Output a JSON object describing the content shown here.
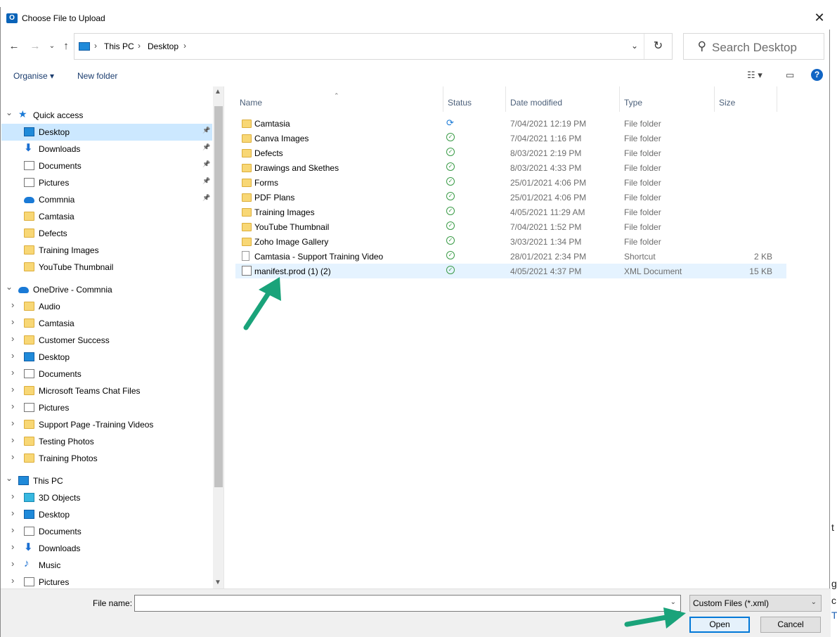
{
  "window": {
    "title": "Choose File to Upload",
    "app_icon": "O",
    "close": "✕"
  },
  "address": {
    "crumbs": [
      "This PC",
      "Desktop"
    ],
    "separator": "›",
    "dropdown": "⌄",
    "refresh": "↻"
  },
  "search": {
    "placeholder": "Search Desktop"
  },
  "toolbar": {
    "organise": "Organise ▾",
    "new_folder": "New folder",
    "view_icon": "☷ ▾",
    "pane_icon": "▭",
    "help": "?"
  },
  "sidebar": [
    {
      "label": "Quick access",
      "icon": "star-icon",
      "level": 0,
      "expanded": true
    },
    {
      "label": "Desktop",
      "icon": "desktop-icon",
      "level": 1,
      "pinned": true,
      "selected": true
    },
    {
      "label": "Downloads",
      "icon": "downloads-icon",
      "level": 1,
      "pinned": true
    },
    {
      "label": "Documents",
      "icon": "documents-icon",
      "level": 1,
      "pinned": true
    },
    {
      "label": "Pictures",
      "icon": "pictures-icon",
      "level": 1,
      "pinned": true
    },
    {
      "label": "Commnia",
      "icon": "cloud-icon",
      "level": 1,
      "pinned": true
    },
    {
      "label": "Camtasia",
      "icon": "folder-icon",
      "level": 1
    },
    {
      "label": "Defects",
      "icon": "folder-icon",
      "level": 1
    },
    {
      "label": "Training Images",
      "icon": "folder-icon",
      "level": 1
    },
    {
      "label": "YouTube Thumbnail",
      "icon": "folder-icon",
      "level": 1
    },
    {
      "label": "OneDrive - Commnia",
      "icon": "cloud-icon",
      "level": 0,
      "expanded": true
    },
    {
      "label": "Audio",
      "icon": "folder-icon",
      "level": 1,
      "collapsed": true
    },
    {
      "label": "Camtasia",
      "icon": "folder-icon",
      "level": 1,
      "collapsed": true
    },
    {
      "label": "Customer Success",
      "icon": "folder-icon",
      "level": 1,
      "collapsed": true
    },
    {
      "label": "Desktop",
      "icon": "desktop-icon",
      "level": 1,
      "collapsed": true
    },
    {
      "label": "Documents",
      "icon": "documents-icon",
      "level": 1,
      "collapsed": true
    },
    {
      "label": "Microsoft Teams Chat Files",
      "icon": "folder-icon",
      "level": 1,
      "collapsed": true
    },
    {
      "label": "Pictures",
      "icon": "pictures-icon",
      "level": 1,
      "collapsed": true
    },
    {
      "label": "Support Page -Training Videos",
      "icon": "shared-folder-icon",
      "level": 1,
      "collapsed": true
    },
    {
      "label": "Testing Photos",
      "icon": "folder-icon",
      "level": 1,
      "collapsed": true
    },
    {
      "label": "Training Photos",
      "icon": "folder-icon",
      "level": 1,
      "collapsed": true
    },
    {
      "label": "This PC",
      "icon": "pc-icon",
      "level": 0,
      "expanded": true
    },
    {
      "label": "3D Objects",
      "icon": "cube-icon",
      "level": 1,
      "collapsed": true
    },
    {
      "label": "Desktop",
      "icon": "desktop-icon",
      "level": 1,
      "collapsed": true
    },
    {
      "label": "Documents",
      "icon": "documents-icon",
      "level": 1,
      "collapsed": true
    },
    {
      "label": "Downloads",
      "icon": "downloads-icon",
      "level": 1,
      "collapsed": true
    },
    {
      "label": "Music",
      "icon": "music-icon",
      "level": 1,
      "collapsed": true
    },
    {
      "label": "Pictures",
      "icon": "pictures-icon",
      "level": 1,
      "collapsed": true
    }
  ],
  "columns": {
    "name": "Name",
    "status": "Status",
    "date": "Date modified",
    "type": "Type",
    "size": "Size"
  },
  "files": [
    {
      "name": "Camtasia",
      "status": "syncing",
      "date": "7/04/2021 12:19 PM",
      "type": "File folder",
      "size": "",
      "icon": "folder-icon"
    },
    {
      "name": "Canva Images",
      "status": "ok",
      "date": "7/04/2021 1:16 PM",
      "type": "File folder",
      "size": "",
      "icon": "folder-icon"
    },
    {
      "name": "Defects",
      "status": "ok",
      "date": "8/03/2021 2:19 PM",
      "type": "File folder",
      "size": "",
      "icon": "folder-icon"
    },
    {
      "name": "Drawings and Skethes",
      "status": "ok",
      "date": "8/03/2021 4:33 PM",
      "type": "File folder",
      "size": "",
      "icon": "folder-icon"
    },
    {
      "name": "Forms",
      "status": "ok",
      "date": "25/01/2021 4:06 PM",
      "type": "File folder",
      "size": "",
      "icon": "folder-icon"
    },
    {
      "name": "PDF Plans",
      "status": "ok",
      "date": "25/01/2021 4:06 PM",
      "type": "File folder",
      "size": "",
      "icon": "folder-icon"
    },
    {
      "name": "Training Images",
      "status": "ok",
      "date": "4/05/2021 11:29 AM",
      "type": "File folder",
      "size": "",
      "icon": "folder-icon"
    },
    {
      "name": "YouTube Thumbnail",
      "status": "ok",
      "date": "7/04/2021 1:52 PM",
      "type": "File folder",
      "size": "",
      "icon": "folder-icon"
    },
    {
      "name": "Zoho Image Gallery",
      "status": "ok",
      "date": "3/03/2021 1:34 PM",
      "type": "File folder",
      "size": "",
      "icon": "folder-icon"
    },
    {
      "name": "Camtasia - Support Training Video",
      "status": "ok",
      "date": "28/01/2021 2:34 PM",
      "type": "Shortcut",
      "size": "2 KB",
      "icon": "shortcut-icon"
    },
    {
      "name": "manifest.prod (1) (2)",
      "status": "ok",
      "date": "4/05/2021 4:37 PM",
      "type": "XML Document",
      "size": "15 KB",
      "icon": "document-icon",
      "selected": true
    }
  ],
  "bottom": {
    "file_name_label": "File name:",
    "file_name_value": "",
    "filter": "Custom Files (*.xml)",
    "open": "Open",
    "cancel": "Cancel"
  },
  "colors": {
    "selection": "#cce8ff",
    "row_hover": "#e5f3ff",
    "accent": "#0078d7",
    "arrow": "#1aa37a"
  }
}
